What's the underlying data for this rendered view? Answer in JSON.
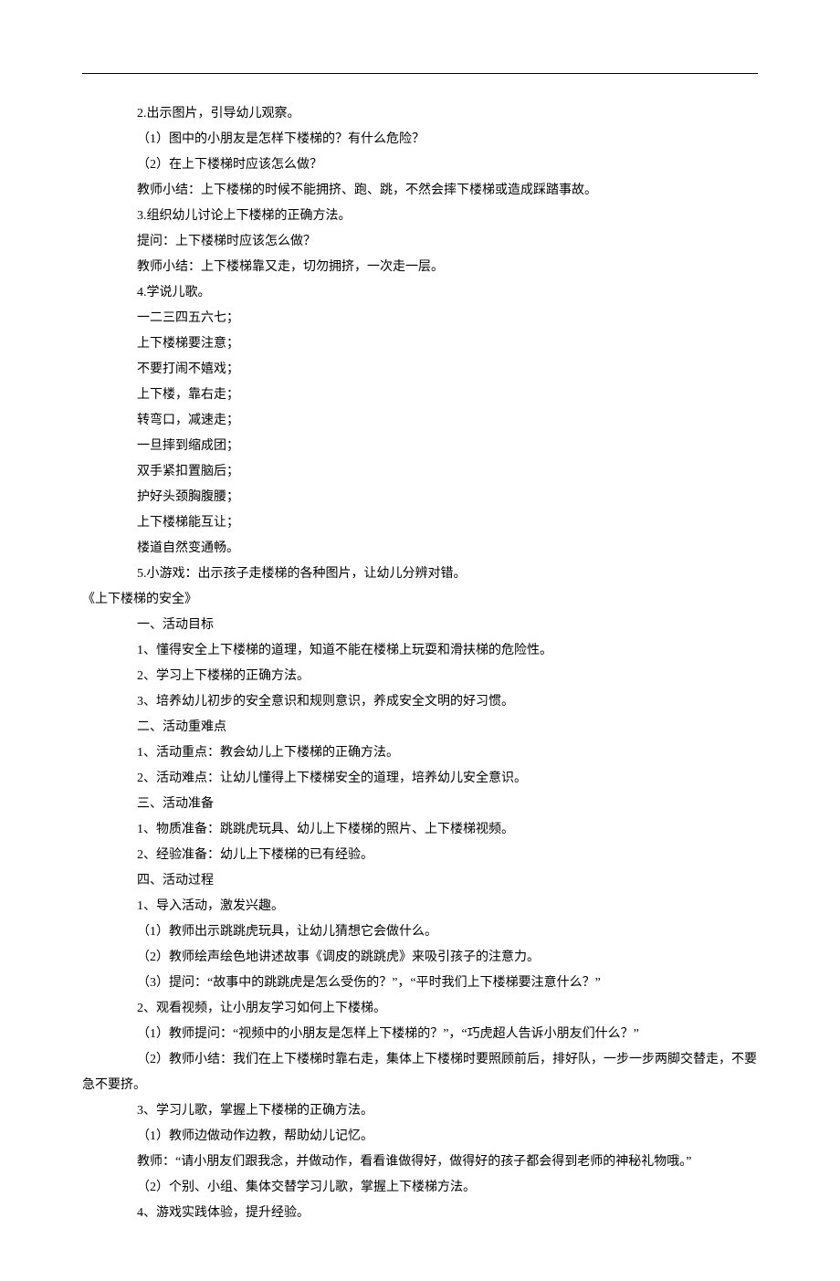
{
  "lines": [
    {
      "cls": "indent-1",
      "text": "2.出示图片，引导幼儿观察。"
    },
    {
      "cls": "indent-1",
      "text": "（1）图中的小朋友是怎样下楼梯的？有什么危险？"
    },
    {
      "cls": "indent-1",
      "text": "（2）在上下楼梯时应该怎么做？"
    },
    {
      "cls": "indent-1",
      "text": "教师小结：上下楼梯的时候不能拥挤、跑、跳，不然会摔下楼梯或造成踩踏事故。"
    },
    {
      "cls": "indent-1",
      "text": "3.组织幼儿讨论上下楼梯的正确方法。"
    },
    {
      "cls": "indent-1",
      "text": "提问：上下楼梯时应该怎么做？"
    },
    {
      "cls": "indent-1",
      "text": "教师小结：上下楼梯靠又走，切勿拥挤，一次走一层。"
    },
    {
      "cls": "indent-1",
      "text": "4.学说儿歌。"
    },
    {
      "cls": "indent-1",
      "text": "一二三四五六七；"
    },
    {
      "cls": "indent-1",
      "text": "上下楼梯要注意；"
    },
    {
      "cls": "indent-1",
      "text": "不要打闹不嬉戏；"
    },
    {
      "cls": "indent-1",
      "text": "上下楼，靠右走；"
    },
    {
      "cls": "indent-1",
      "text": "转弯口，减速走；"
    },
    {
      "cls": "indent-1",
      "text": "一旦摔到缩成团；"
    },
    {
      "cls": "indent-1",
      "text": "双手紧扣置脑后；"
    },
    {
      "cls": "indent-1",
      "text": "护好头颈胸腹腰；"
    },
    {
      "cls": "indent-1",
      "text": "上下楼梯能互让；"
    },
    {
      "cls": "indent-1",
      "text": "楼道自然变通畅。"
    },
    {
      "cls": "indent-1",
      "text": "5.小游戏：出示孩子走楼梯的各种图片，让幼儿分辨对错。"
    },
    {
      "cls": "indent-0",
      "text": "《上下楼梯的安全》"
    },
    {
      "cls": "indent-1",
      "text": "一、活动目标"
    },
    {
      "cls": "indent-1",
      "text": "1、懂得安全上下楼梯的道理，知道不能在楼梯上玩耍和滑扶梯的危险性。"
    },
    {
      "cls": "indent-1",
      "text": "2、学习上下楼梯的正确方法。"
    },
    {
      "cls": "indent-1",
      "text": "3、培养幼儿初步的安全意识和规则意识，养成安全文明的好习惯。"
    },
    {
      "cls": "indent-1",
      "text": "二、活动重难点"
    },
    {
      "cls": "indent-1",
      "text": "1、活动重点：教会幼儿上下楼梯的正确方法。"
    },
    {
      "cls": "indent-1",
      "text": "2、活动难点：让幼儿懂得上下楼梯安全的道理，培养幼儿安全意识。"
    },
    {
      "cls": "indent-1",
      "text": "三、活动准备"
    },
    {
      "cls": "indent-1",
      "text": "1、物质准备：跳跳虎玩具、幼儿上下楼梯的照片、上下楼梯视频。"
    },
    {
      "cls": "indent-1",
      "text": "2、经验准备：幼儿上下楼梯的已有经验。"
    },
    {
      "cls": "indent-1",
      "text": "四、活动过程"
    },
    {
      "cls": "indent-1",
      "text": "1、导入活动，激发兴趣。"
    },
    {
      "cls": "indent-1",
      "text": "（1）教师出示跳跳虎玩具，让幼儿猜想它会做什么。"
    },
    {
      "cls": "indent-1",
      "text": "（2）教师绘声绘色地讲述故事《调皮的跳跳虎》来吸引孩子的注意力。"
    },
    {
      "cls": "indent-1",
      "text": "（3）提问：“故事中的跳跳虎是怎么受伤的？”，“平时我们上下楼梯要注意什么？”"
    },
    {
      "cls": "indent-1",
      "text": "2、观看视频，让小朋友学习如何上下楼梯。"
    },
    {
      "cls": "indent-1",
      "text": "（1）教师提问：“视频中的小朋友是怎样上下楼梯的？”，“巧虎超人告诉小朋友们什么？”"
    },
    {
      "cls": "hang",
      "text": "（2）教师小结：我们在上下楼梯时靠右走，集体上下楼梯时要照顾前后，排好队，一步一步两脚交替走，不要急不要挤。"
    },
    {
      "cls": "indent-1",
      "text": "3、学习儿歌，掌握上下楼梯的正确方法。"
    },
    {
      "cls": "indent-1",
      "text": "（1）教师边做动作边教，帮助幼儿记忆。"
    },
    {
      "cls": "indent-1",
      "text": "教师：“请小朋友们跟我念，并做动作，看看谁做得好，做得好的孩子都会得到老师的神秘礼物哦。”"
    },
    {
      "cls": "indent-1",
      "text": "（2）个别、小组、集体交替学习儿歌，掌握上下楼梯方法。"
    },
    {
      "cls": "indent-1",
      "text": "4、游戏实践体验，提升经验。"
    }
  ]
}
